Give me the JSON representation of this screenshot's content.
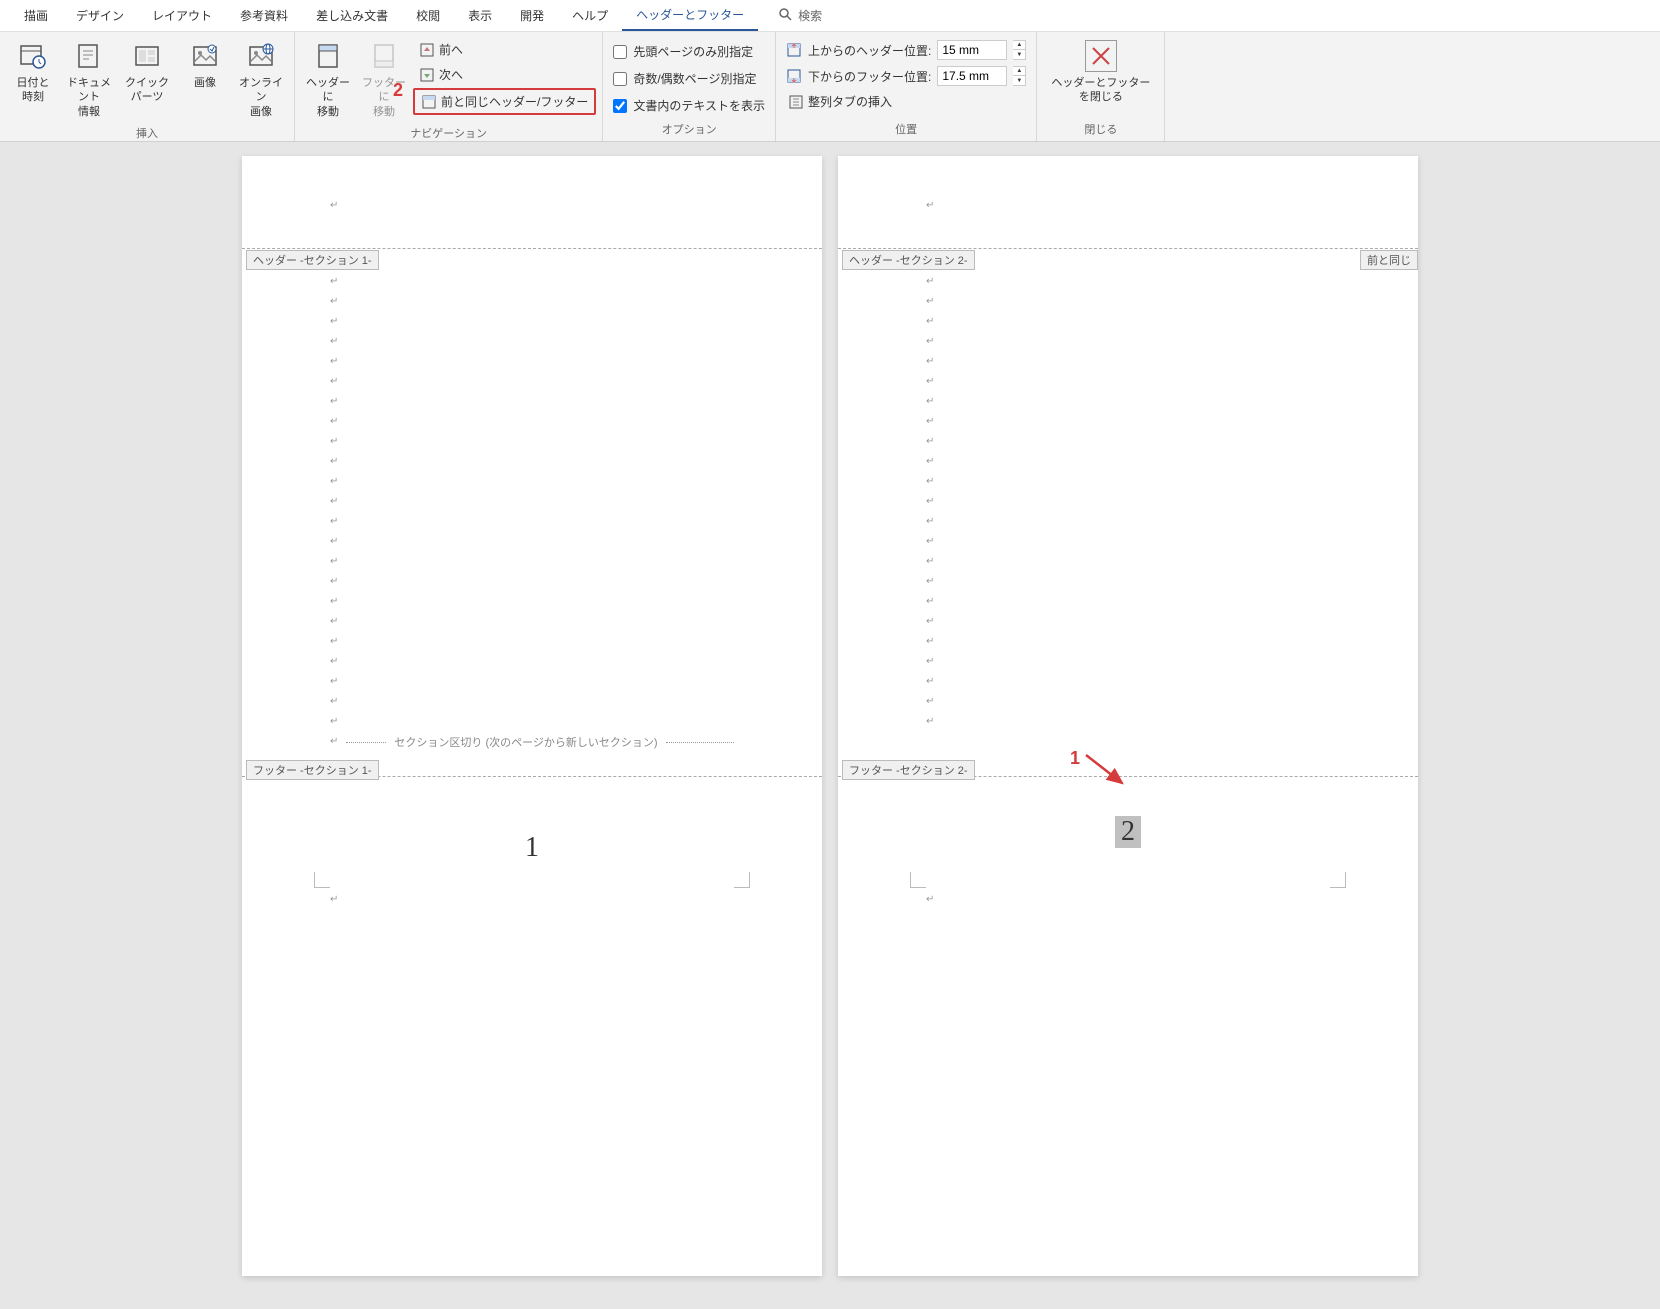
{
  "tabs": {
    "draw": "描画",
    "design": "デザイン",
    "layout": "レイアウト",
    "references": "参考資料",
    "mailings": "差し込み文書",
    "review": "校閲",
    "view": "表示",
    "developer": "開発",
    "help": "ヘルプ",
    "header_footer": "ヘッダーとフッター",
    "search": "検索"
  },
  "groups": {
    "insert": {
      "label": "挿入",
      "date_time": "日付と\n時刻",
      "doc_info": "ドキュメント\n情報",
      "quick_parts": "クイック パーツ",
      "image": "画像",
      "online_image": "オンライン\n画像"
    },
    "navigation": {
      "label": "ナビゲーション",
      "goto_header": "ヘッダーに\n移動",
      "goto_footer": "フッターに\n移動",
      "prev": "前へ",
      "next": "次へ",
      "link_previous": "前と同じヘッダー/フッター"
    },
    "options": {
      "label": "オプション",
      "diff_first": "先頭ページのみ別指定",
      "diff_odd_even": "奇数/偶数ページ別指定",
      "show_text": "文書内のテキストを表示"
    },
    "position": {
      "label": "位置",
      "header_top": "上からのヘッダー位置:",
      "footer_bottom": "下からのフッター位置:",
      "header_value": "15 mm",
      "footer_value": "17.5 mm",
      "align_tab": "整列タブの挿入"
    },
    "close": {
      "label": "閉じる",
      "button": "ヘッダーとフッター\nを閉じる"
    }
  },
  "pages": {
    "left": {
      "header_tag": "ヘッダー -セクション 1-",
      "footer_tag": "フッター -セクション 1-",
      "section_break": "セクション区切り (次のページから新しいセクション)",
      "page_number": "1"
    },
    "right": {
      "header_tag": "ヘッダー -セクション 2-",
      "footer_tag": "フッター -セクション 2-",
      "same_as_prev": "前と同じ",
      "page_number": "2"
    }
  },
  "annotations": {
    "marker1": "1",
    "marker2": "2"
  }
}
